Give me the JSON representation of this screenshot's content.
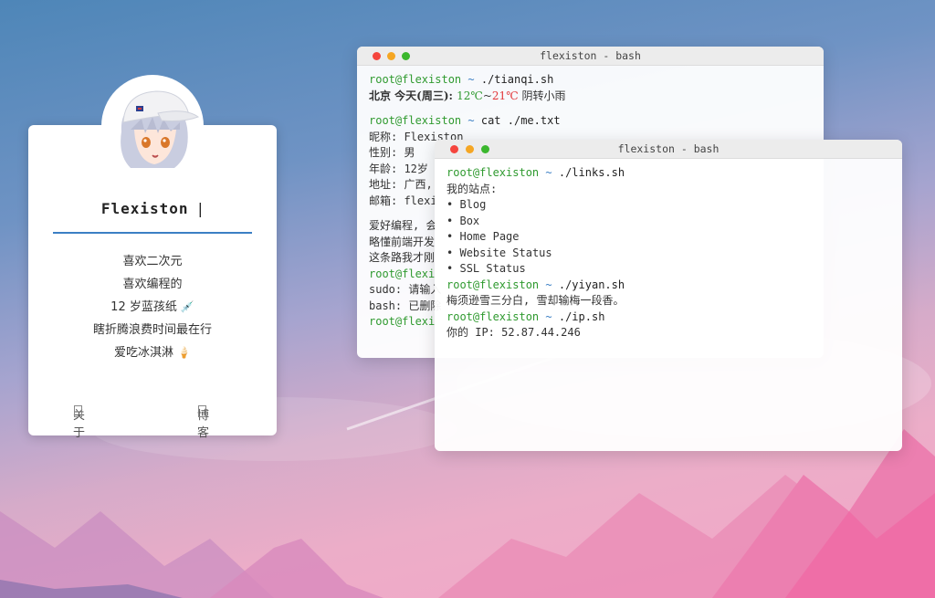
{
  "profile": {
    "name": "Flexiston",
    "cursor": "|",
    "bio": [
      {
        "text": "喜欢二次元",
        "emoji": ""
      },
      {
        "text": "喜欢编程的",
        "emoji": ""
      },
      {
        "text": "12 岁蓝孩纸",
        "emoji": "💉"
      },
      {
        "text": "瞎折腾浪费时间最在行",
        "emoji": ""
      },
      {
        "text": "爱吃冰淇淋",
        "emoji": "🍦"
      }
    ],
    "links": [
      {
        "label": "关于"
      },
      {
        "label": "博客"
      }
    ]
  },
  "term1": {
    "title": "flexiston - bash",
    "prompt_user": "root@flexiston",
    "prompt_tilde": "~",
    "cmd1": "./tianqi.sh",
    "weather": {
      "prefix": "北京 今天(周三): ",
      "low": "12℃",
      "sep": "~",
      "high": "21℃",
      "desc": " 阴转小雨"
    },
    "cmd2": "cat ./me.txt",
    "me_lines": [
      "昵称: Flexiston",
      "性别: 男",
      "年龄: 12岁",
      "地址: 广西,",
      "邮箱: flexi"
    ],
    "about_lines": [
      "爱好编程, 会",
      "略懂前端开发",
      "这条路我才刚"
    ],
    "err_prompt": "root@flexi",
    "err_lines": [
      "sudo: 请输入",
      "bash: 已删除"
    ],
    "last_prompt": "root@flexi"
  },
  "term2": {
    "title": "flexiston - bash",
    "prompt_user": "root@flexiston",
    "prompt_tilde": "~",
    "cmd1": "./links.sh",
    "sites_title": "我的站点:",
    "sites": [
      "Blog",
      "Box",
      "Home Page",
      "Website Status",
      "SSL Status"
    ],
    "bullet": "•",
    "cmd2": "./yiyan.sh",
    "yiyan": "梅须逊雪三分白, 雪却输梅一段香。",
    "cmd3": "./ip.sh",
    "ip_line": "你的 IP: 52.87.44.246"
  },
  "colors": {
    "prompt": "#2f9a2f",
    "accent": "#3b7fc4",
    "hot": "#e2383b"
  }
}
